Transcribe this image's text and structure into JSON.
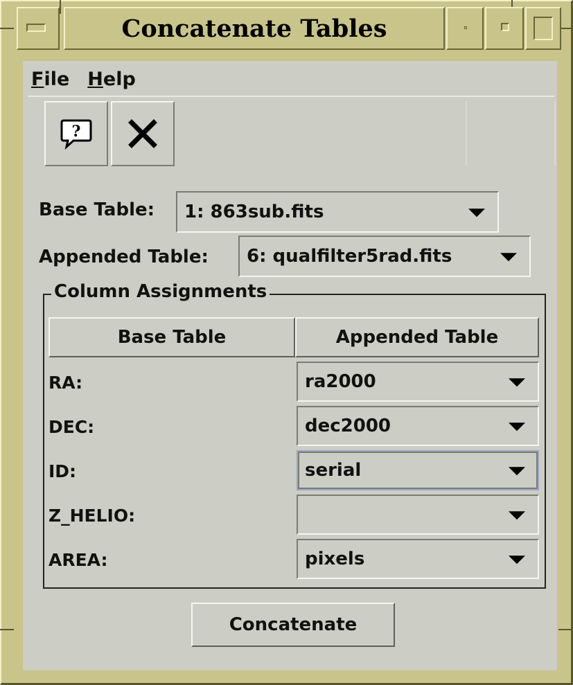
{
  "window": {
    "title": "Concatenate Tables"
  },
  "menu": {
    "items": [
      {
        "label": "File",
        "mnemonic": "F",
        "rest": "ile"
      },
      {
        "label": "Help",
        "mnemonic": "H",
        "rest": "elp"
      }
    ]
  },
  "toolbar": {
    "buttons": [
      {
        "name": "help",
        "icon": "help-bubble-icon"
      },
      {
        "name": "close",
        "icon": "close-x-icon"
      }
    ]
  },
  "base_table": {
    "label": "Base Table:",
    "value": "1: 863sub.fits"
  },
  "appended_table": {
    "label": "Appended Table:",
    "value": "6: qualfilter5rad.fits"
  },
  "column_assignments": {
    "title": "Column Assignments",
    "headers": [
      "Base Table",
      "Appended Table"
    ],
    "rows": [
      {
        "base": "RA:",
        "appended": "ra2000"
      },
      {
        "base": "DEC:",
        "appended": "dec2000"
      },
      {
        "base": "ID:",
        "appended": "serial"
      },
      {
        "base": "Z_HELIO:",
        "appended": ""
      },
      {
        "base": "AREA:",
        "appended": "pixels"
      }
    ]
  },
  "actions": {
    "concatenate_label": "Concatenate"
  }
}
